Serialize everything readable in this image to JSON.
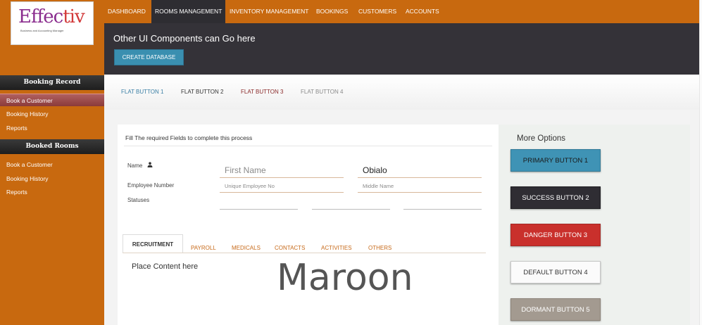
{
  "logo": {
    "name_main": "Effec",
    "name_accent": "tiv",
    "tagline": "Business and Accounting Manager"
  },
  "sidebar": {
    "sections": [
      {
        "header": "Booking Record",
        "items": [
          "Book a Customer",
          "Booking History",
          "Reports"
        ]
      },
      {
        "header": "Booked Rooms",
        "items": [
          "Book a Customer",
          "Booking History",
          "Reports"
        ]
      }
    ]
  },
  "nav": {
    "items": [
      "DASHBOARD",
      "ROOMS MANAGEMENT",
      "INVENTORY MANAGEMENT",
      "BOOKINGS",
      "CUSTOMERS",
      "ACCOUNTS"
    ],
    "active": "ROOMS MANAGEMENT"
  },
  "header": {
    "title": "Other UI Components can Go here",
    "create_button": "CREATE DATABASE"
  },
  "flat_buttons": [
    {
      "label": "FLAT BUTTON 1",
      "color": "#3a7fa5"
    },
    {
      "label": "FLAT BUTTON 2",
      "color": "#333333"
    },
    {
      "label": "FLAT BUTTON 3",
      "color": "#8a2a2a"
    },
    {
      "label": "FLAT BUTTON 4",
      "color": "#8a8a8a"
    }
  ],
  "form": {
    "title": "Fill The required Fields to complete this process",
    "labels": {
      "name": "Name",
      "employee_number": "Employee Number",
      "statuses": "Statuses"
    },
    "first_name_placeholder": "First Name",
    "last_name_value": "Obialo",
    "employee_no_placeholder": "Unique Employee No",
    "middle_name_placeholder": "Middle Name"
  },
  "tabs": [
    "RECRUITMENT",
    "PAYROLL",
    "MEDICALS",
    "CONTACTS",
    "ACTIVITIES",
    "OTHERS"
  ],
  "content": {
    "placeholder": "Place Content here",
    "big_label": "Maroon"
  },
  "more_options": {
    "title": "More Options",
    "buttons": [
      {
        "label": "PRIMARY BUTTON 1",
        "bg": "#3f93b5",
        "fg": "#1a1a1a"
      },
      {
        "label": "SUCCESS BUTTON 2",
        "bg": "#2f2d33",
        "fg": "#ffffff"
      },
      {
        "label": "DANGER BUTTON 3",
        "bg": "#c9302c",
        "fg": "#ffffff"
      },
      {
        "label": "DEFAULT BUTTON 4",
        "bg": "#fbfbfb",
        "fg": "#333333"
      },
      {
        "label": "DORMANT BUTTON 5",
        "bg": "#a39a90",
        "fg": "#ffffff"
      }
    ]
  },
  "colors": {
    "brand_orange": "#c8690f",
    "dark": "#343238",
    "accent_blue": "#3a8fb0",
    "tab_orange": "#c76a1a"
  }
}
